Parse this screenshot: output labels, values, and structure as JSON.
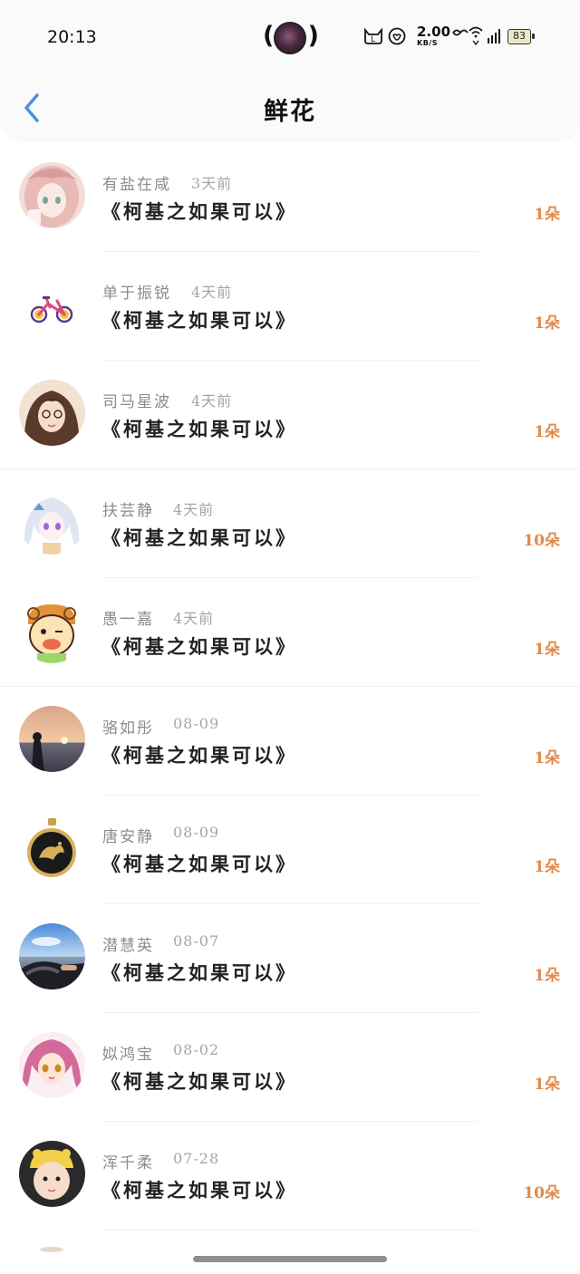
{
  "status_bar": {
    "time": "20:13",
    "net_speed_value": "2.00",
    "net_speed_unit": "KB/S",
    "battery_level": "83",
    "icons": [
      "cat-icon",
      "heart-face-icon",
      "hd-signal-icon",
      "wifi-icon",
      "signal-bars-icon",
      "battery-icon"
    ]
  },
  "header": {
    "title": "鲜花",
    "back_icon": "chevron-left-icon"
  },
  "colors": {
    "accent_back": "#4a90e2",
    "count_orange": "#e08a4c",
    "name_gray": "#8c8c8c"
  },
  "list": [
    {
      "name": "有盐在咸",
      "time": "3天前",
      "book": "《柯基之如果可以》",
      "count": "1朵"
    },
    {
      "name": "单于振锐",
      "time": "4天前",
      "book": "《柯基之如果可以》",
      "count": "1朵"
    },
    {
      "name": "司马星波",
      "time": "4天前",
      "book": "《柯基之如果可以》",
      "count": "1朵"
    },
    {
      "name": "扶芸静",
      "time": "4天前",
      "book": "《柯基之如果可以》",
      "count": "10朵"
    },
    {
      "name": "愚一嘉",
      "time": "4天前",
      "book": "《柯基之如果可以》",
      "count": "1朵"
    },
    {
      "name": "骆如彤",
      "time": "08-09",
      "book": "《柯基之如果可以》",
      "count": "1朵"
    },
    {
      "name": "唐安静",
      "time": "08-09",
      "book": "《柯基之如果可以》",
      "count": "1朵"
    },
    {
      "name": "潜慧英",
      "time": "08-07",
      "book": "《柯基之如果可以》",
      "count": "1朵"
    },
    {
      "name": "姒鸿宝",
      "time": "08-02",
      "book": "《柯基之如果可以》",
      "count": "1朵"
    },
    {
      "name": "浑千柔",
      "time": "07-28",
      "book": "《柯基之如果可以》",
      "count": "10朵"
    }
  ]
}
